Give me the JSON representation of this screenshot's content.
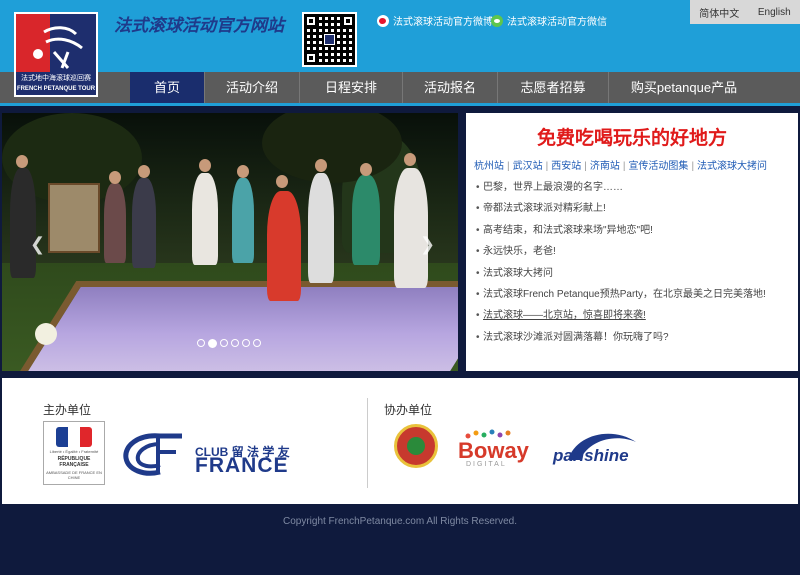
{
  "header": {
    "logo": {
      "line1": "法式地中海滚球巡回赛",
      "line2": "FRENCH PETANQUE TOUR"
    },
    "site_title": "法式滚球活动官方网站",
    "social": {
      "weibo_label": "法式滚球活动官方微博",
      "wechat_label": "法式滚球活动官方微信"
    },
    "lang": {
      "chinese": "简体中文",
      "english": "English"
    }
  },
  "nav": {
    "items": [
      {
        "label": "首页",
        "active": true
      },
      {
        "label": "活动介绍"
      },
      {
        "label": "日程安排"
      },
      {
        "label": "活动报名"
      },
      {
        "label": "志愿者招募"
      },
      {
        "label": "购买petanque产品"
      }
    ]
  },
  "carousel": {
    "dots": 6,
    "active_dot": 1
  },
  "panel": {
    "title": "免费吃喝玩乐的好地方",
    "stations": [
      "杭州站",
      "武汉站",
      "西安站",
      "济南站",
      "宣传活动图集",
      "法式滚球大拷问"
    ],
    "news": [
      "巴黎，世界上最浪漫的名字……",
      "帝都法式滚球派对精彩献上!",
      "高考结束，和法式滚球来场\"异地恋\"吧!",
      "永远快乐，老爸!",
      "法式滚球大拷问",
      "法式滚球French Petanque预热Party，在北京最美之日完美落地!",
      "法式滚球——北京站，惊喜即将来袭!",
      "法式滚球沙滩派对圆满落幕！你玩嗨了吗?"
    ]
  },
  "sponsors": {
    "host_title": "主办单位",
    "co_title": "协办单位",
    "ambassade": {
      "motto": "Liberté • Égalité • Fraternité",
      "republic": "RÉPUBLIQUE FRANÇAISE",
      "name": "AMBASSADE DE FRANCE EN CHINE"
    },
    "club_france": {
      "club": "CLUB 留 法 学 友",
      "france": "FRANCE"
    },
    "boway": {
      "name": "Boway",
      "sub": "DIGITAL"
    },
    "parishine": "parishine"
  },
  "footer": {
    "copyright": "Copyright FrenchPetanque.com All Rights Reserved."
  },
  "colors": {
    "header_blue": "#1f9fd8",
    "nav_grey": "#5b5b5b",
    "nav_active": "#1a2d6d",
    "page_navy": "#0f1a3d",
    "title_red": "#e01a1a"
  }
}
